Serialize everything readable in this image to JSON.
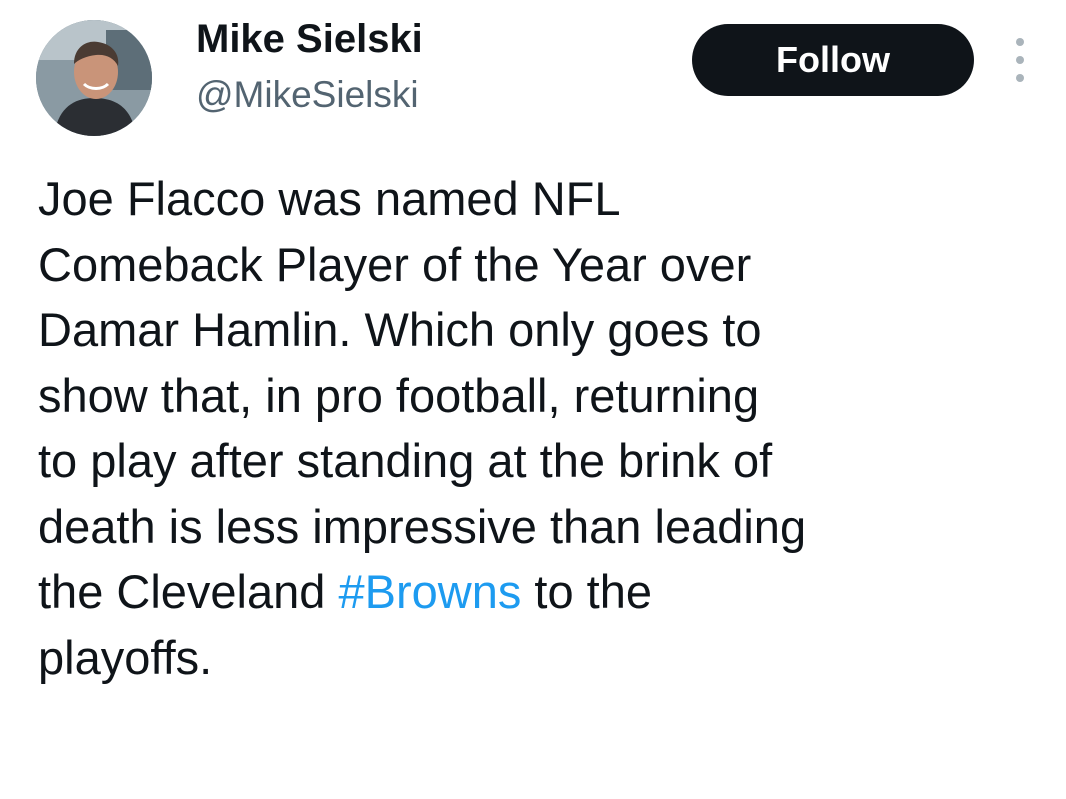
{
  "author": {
    "display_name": "Mike Sielski",
    "handle": "@MikeSielski",
    "avatar_icon": "profile-photo"
  },
  "actions": {
    "follow_label": "Follow",
    "more_icon": "vertical-ellipsis-icon"
  },
  "tweet": {
    "lines": [
      "Joe Flacco was named NFL",
      "Comeback Player of the Year over",
      "Damar Hamlin. Which only goes to",
      "show that, in pro football, returning",
      "to play after standing at the brink of",
      "death is less impressive than leading"
    ],
    "line7_before": "the Cleveland ",
    "hashtag": "#Browns",
    "line7_after": " to the",
    "line8": "playoffs."
  },
  "colors": {
    "text": "#0f1419",
    "secondary": "#536471",
    "link": "#1d9bf0",
    "button": "#0f1419"
  }
}
